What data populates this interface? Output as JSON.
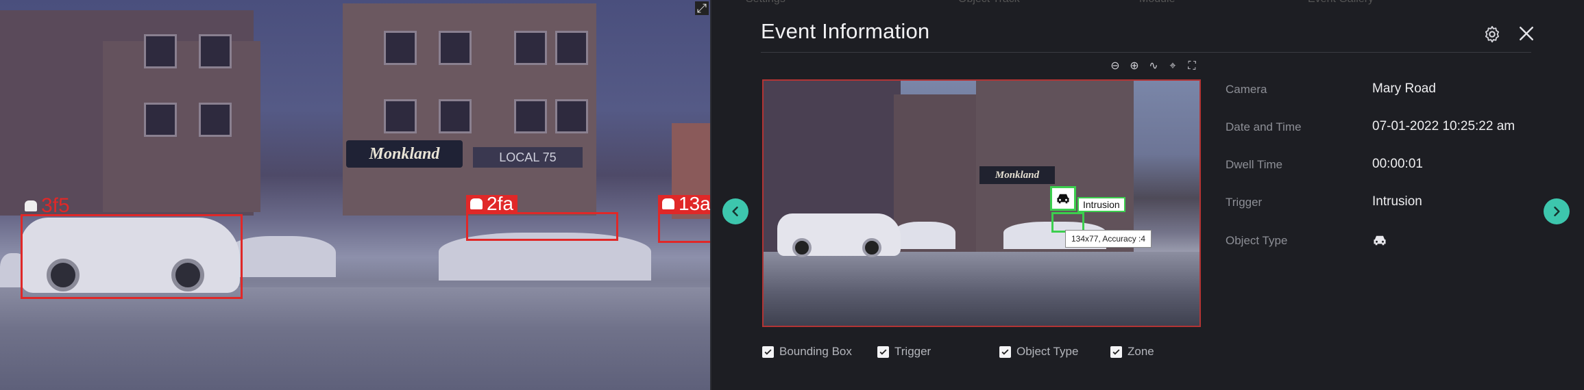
{
  "feed": {
    "expand_icon": "expand-icon",
    "detections": [
      {
        "id": "3f5",
        "style": "outlined",
        "icon": "car-icon"
      },
      {
        "id": "2fa",
        "style": "filled",
        "icon": "car-icon"
      },
      {
        "id": "13a",
        "style": "filled",
        "icon": "car-icon"
      }
    ],
    "sign_text": "Monkland",
    "sign2_text": "LOCAL 75"
  },
  "panel": {
    "ghost_tabs": [
      "Settings",
      "Object Track",
      "Module",
      "Event Gallery"
    ],
    "title": "Event Information",
    "icons": {
      "settings": "gear-icon",
      "close": "close-icon"
    },
    "toolbar": [
      {
        "name": "zoom-out-icon",
        "glyph": "⊖"
      },
      {
        "name": "zoom-in-icon",
        "glyph": "⊕"
      },
      {
        "name": "track-path-icon",
        "glyph": "∿"
      },
      {
        "name": "crosshair-icon",
        "glyph": "⌖"
      },
      {
        "name": "fullscreen-icon",
        "glyph": "⛶"
      }
    ],
    "preview": {
      "trigger_label": "Intrusion",
      "tooltip": "134x77, Accuracy :4",
      "object_icon": "car-icon"
    },
    "details": [
      {
        "label": "Camera",
        "value": "Mary Road"
      },
      {
        "label": "Date and Time",
        "value": "07-01-2022 10:25:22 am"
      },
      {
        "label": "Dwell Time",
        "value": "00:00:01"
      },
      {
        "label": "Trigger",
        "value": "Intrusion"
      },
      {
        "label": "Object Type",
        "value": "",
        "icon": "car-icon"
      }
    ],
    "checkboxes": [
      {
        "label": "Bounding Box",
        "checked": true
      },
      {
        "label": "Trigger",
        "checked": true
      },
      {
        "label": "Object Type",
        "checked": true
      },
      {
        "label": "Zone",
        "checked": true
      }
    ],
    "nav": {
      "prev": "chevron-left-icon",
      "next": "chevron-right-icon"
    }
  },
  "colors": {
    "detection_red": "#e02828",
    "trigger_green": "#3ccf4e",
    "accent_teal": "#3dc6ad",
    "panel_bg": "#1d1e23"
  }
}
